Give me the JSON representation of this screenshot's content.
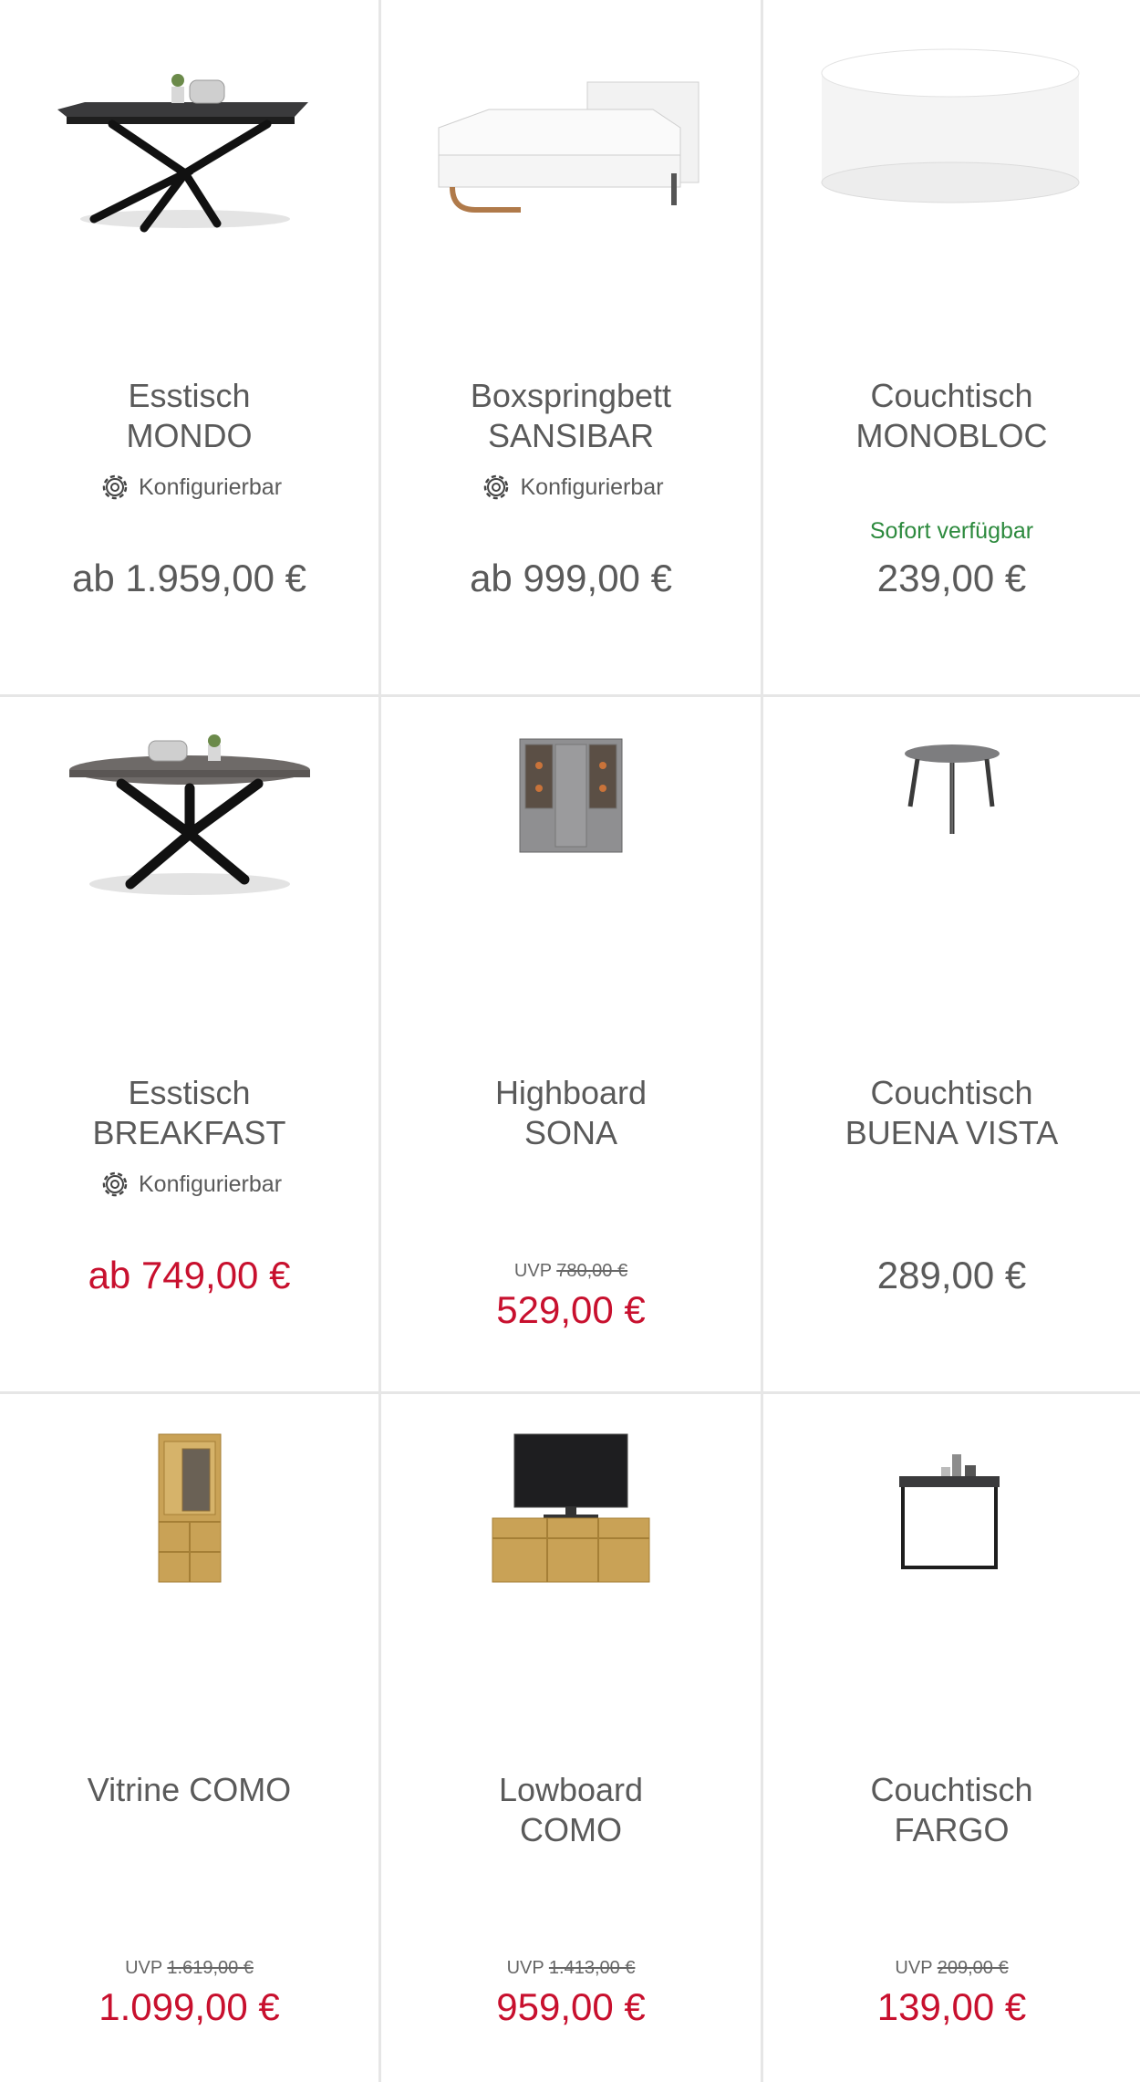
{
  "products": [
    {
      "id": "esstisch-mondo",
      "title": [
        "Esstisch",
        "MONDO"
      ],
      "configurable": "Konfigurierbar",
      "price": "ab 1.959,00 €",
      "sale": false
    },
    {
      "id": "boxspringbett-sansibar",
      "title": [
        "Boxspringbett",
        "SANSIBAR"
      ],
      "configurable": "Konfigurierbar",
      "price": "ab 999,00 €",
      "sale": false
    },
    {
      "id": "couchtisch-monobloc",
      "title": [
        "Couchtisch",
        "MONOBLOC"
      ],
      "availability": "Sofort verfügbar",
      "price": "239,00 €",
      "sale": false
    },
    {
      "id": "esstisch-breakfast",
      "title": [
        "Esstisch",
        "BREAKFAST"
      ],
      "configurable": "Konfigurierbar",
      "price": "ab 749,00 €",
      "sale": true
    },
    {
      "id": "highboard-sona",
      "title": [
        "Highboard",
        "SONA"
      ],
      "uvp_label": "UVP",
      "uvp_value": "780,00 €",
      "price": "529,00 €",
      "sale": true
    },
    {
      "id": "couchtisch-buena-vista",
      "title": [
        "Couchtisch",
        "BUENA VISTA"
      ],
      "price": "289,00 €",
      "sale": false
    },
    {
      "id": "vitrine-como",
      "title": [
        "Vitrine COMO"
      ],
      "uvp_label": "UVP",
      "uvp_value": "1.619,00 €",
      "price": "1.099,00 €",
      "sale": true
    },
    {
      "id": "lowboard-como",
      "title": [
        "Lowboard",
        "COMO"
      ],
      "uvp_label": "UVP",
      "uvp_value": "1.413,00 €",
      "price": "959,00 €",
      "sale": true
    },
    {
      "id": "couchtisch-fargo",
      "title": [
        "Couchtisch",
        "FARGO"
      ],
      "uvp_label": "UVP",
      "uvp_value": "209,00 €",
      "price": "139,00 €",
      "sale": true
    }
  ],
  "icons": {
    "configurable": "gear-icon"
  },
  "colors": {
    "sale": "#c8102e",
    "available": "#2d8a3e",
    "text": "#5a5a5a",
    "divider": "#e6e6e6"
  }
}
